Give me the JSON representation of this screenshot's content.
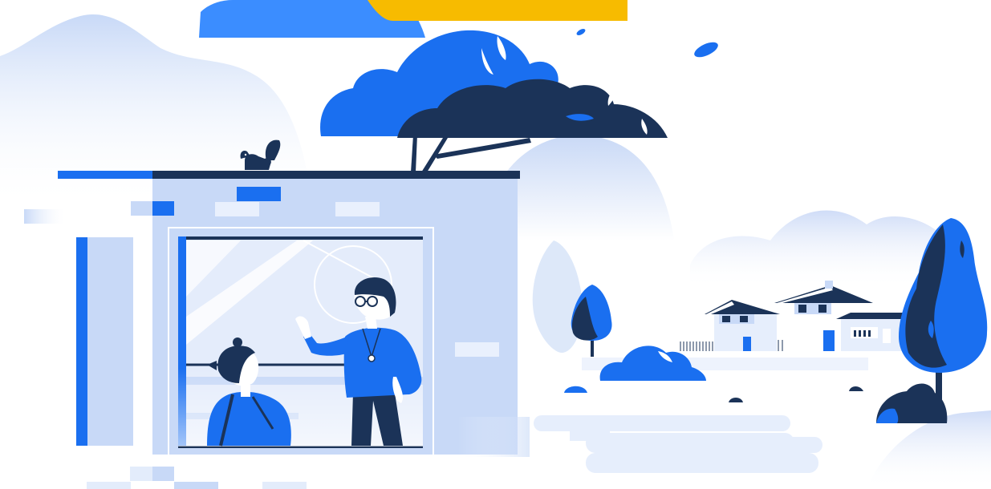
{
  "scene": {
    "kind": "flat vector illustration",
    "colors": {
      "primary": "#1a6ff0",
      "primary_light": "#3b8dff",
      "navy": "#1b3358",
      "pale_blue": "#c8d9f7",
      "mist": "#e6eefc",
      "accent_yellow": "#f7bb00",
      "background": "#ffffff"
    }
  }
}
